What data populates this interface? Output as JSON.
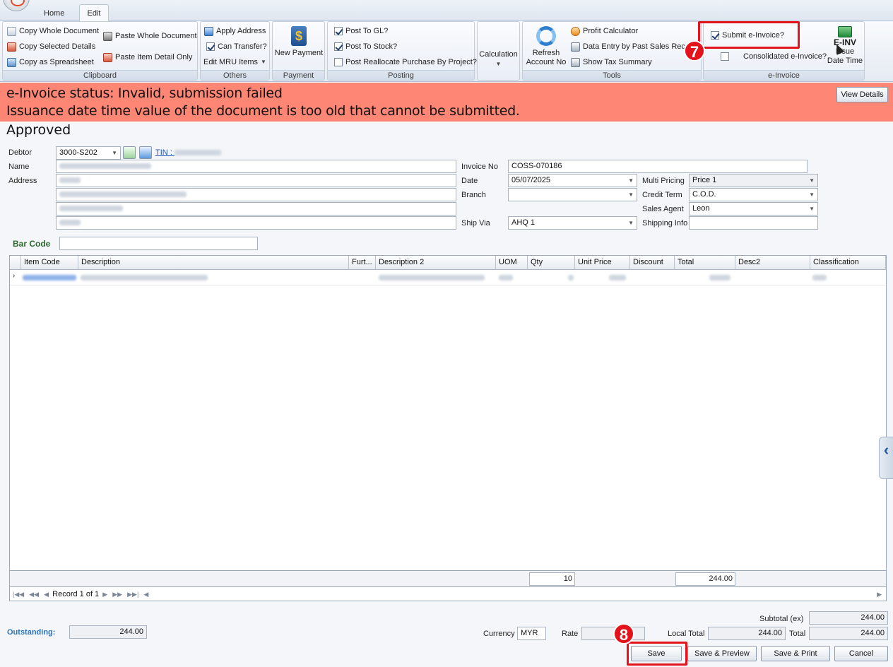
{
  "ribbon": {
    "tabs": [
      "Home",
      "Edit"
    ],
    "clipboard": {
      "label": "Clipboard",
      "copy_whole": "Copy Whole Document",
      "copy_selected": "Copy Selected Details",
      "copy_spreadsheet": "Copy as Spreadsheet",
      "paste_whole": "Paste Whole Document",
      "paste_item": "Paste Item Detail Only"
    },
    "others": {
      "label": "Others",
      "apply_address": "Apply Address",
      "can_transfer": "Can Transfer?",
      "edit_mru": "Edit MRU Items"
    },
    "payment": {
      "label": "Payment",
      "new_payment": "New Payment"
    },
    "posting": {
      "label": "Posting",
      "post_gl": "Post To GL?",
      "post_stock": "Post To Stock?",
      "post_reallocate": "Post Reallocate Purchase By Project?"
    },
    "calculation": {
      "label": "Calculation"
    },
    "tools": {
      "label": "Tools",
      "refresh_line1": "Refresh",
      "refresh_line2": "Account No",
      "profit_calc": "Profit Calculator",
      "data_entry": "Data Entry by Past Sales Reco",
      "tax_summary": "Show Tax Summary"
    },
    "einvoice": {
      "label": "e-Invoice",
      "submit": "Submit e-Invoice?",
      "consolidated": "Consolidated e-Invoice?",
      "einv_icon_text": "E-INV",
      "issue_line1": "Issue",
      "issue_line2": "Date Time"
    }
  },
  "annotations": {
    "step7": "7",
    "step8": "8"
  },
  "banner": {
    "status": "e-Invoice status: Invalid, submission failed",
    "message": "Issuance date time value of the document is too old that cannot be submitted.",
    "view_details": "View Details"
  },
  "doc_status": "Approved",
  "form": {
    "debtor_label": "Debtor",
    "debtor_value": "3000-S202",
    "tin_label": "TIN :",
    "name_label": "Name",
    "address_label": "Address",
    "invoice_no_label": "Invoice No",
    "invoice_no": "COSS-070186",
    "date_label": "Date",
    "date": "05/07/2025",
    "branch_label": "Branch",
    "branch": "",
    "ship_via_label": "Ship Via",
    "ship_via": "AHQ 1",
    "multi_pricing_label": "Multi Pricing",
    "multi_pricing": "Price 1",
    "credit_term_label": "Credit Term",
    "credit_term": "C.O.D.",
    "sales_agent_label": "Sales Agent",
    "sales_agent": "Leon",
    "shipping_info_label": "Shipping Info",
    "shipping_info": "",
    "bar_code_label": "Bar Code"
  },
  "grid": {
    "columns": [
      "Item Code",
      "Description",
      "Furt...",
      "Description 2",
      "UOM",
      "Qty",
      "Unit Price",
      "Discount",
      "Total",
      "Desc2",
      "Classification"
    ],
    "footer_qty": "10",
    "footer_total": "244.00",
    "record_text": "Record 1 of 1"
  },
  "totals": {
    "outstanding_label": "Outstanding:",
    "outstanding": "244.00",
    "subtotal_label": "Subtotal (ex)",
    "subtotal": "244.00",
    "currency_label": "Currency",
    "currency": "MYR",
    "rate_label": "Rate",
    "local_total_label": "Local Total",
    "local_total": "244.00",
    "total_label": "Total",
    "total": "244.00"
  },
  "buttons": {
    "save": "Save",
    "save_preview": "Save & Preview",
    "save_print": "Save & Print",
    "cancel": "Cancel"
  }
}
